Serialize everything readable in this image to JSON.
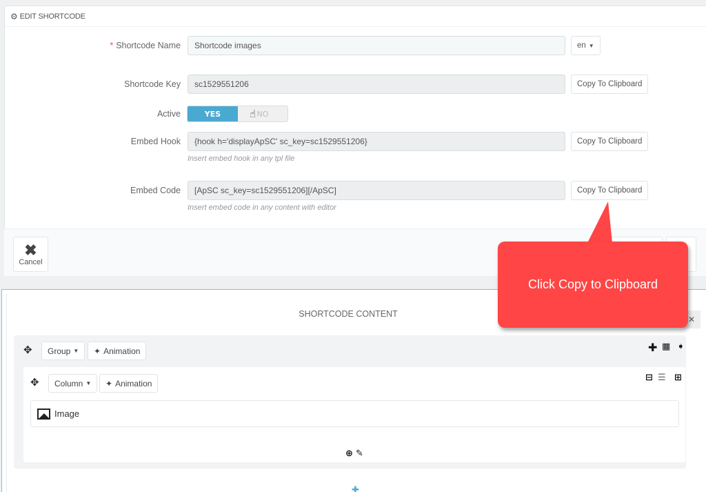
{
  "edit_panel": {
    "title": "EDIT SHORTCODE",
    "icon": "cogs-icon",
    "fields": {
      "name": {
        "label": "Shortcode Name",
        "required_mark": "*",
        "value": "Shortcode images",
        "lang": "en"
      },
      "key": {
        "label": "Shortcode Key",
        "value": "sc1529551206",
        "button": "Copy To Clipboard"
      },
      "active": {
        "label": "Active",
        "yes": "YES",
        "no": "NO",
        "selected": "YES"
      },
      "hook": {
        "label": "Embed Hook",
        "value": "{hook h='displayApSC' sc_key=sc1529551206}",
        "help": "Insert embed hook in any tpl file",
        "button": "Copy To Clipboard"
      },
      "code": {
        "label": "Embed Code",
        "value": "[ApSC sc_key=sc1529551206][/ApSC]",
        "help": "Insert embed code in any content with editor",
        "button": "Copy To Clipboard"
      }
    },
    "footer": {
      "cancel": "Cancel"
    }
  },
  "content_panel": {
    "title": "SHORTCODE CONTENT",
    "group": {
      "dropdown": "Group",
      "animation": "Animation",
      "icons": [
        "plus-icon",
        "grid-icon",
        "circle-down-icon"
      ]
    },
    "column": {
      "dropdown": "Column",
      "animation": "Animation",
      "icons": [
        "minus-square-icon",
        "bars-icon",
        "plus-square-icon"
      ]
    },
    "widget": {
      "label": "Image",
      "icon": "image-icon"
    },
    "bottom_icons": [
      "plus-circle-icon",
      "pencil-icon"
    ]
  },
  "callout": {
    "text": "Click Copy to Clipboard",
    "color": "#ff4545"
  },
  "colors": {
    "accent": "#4aa9d1",
    "callout": "#ff4545"
  }
}
